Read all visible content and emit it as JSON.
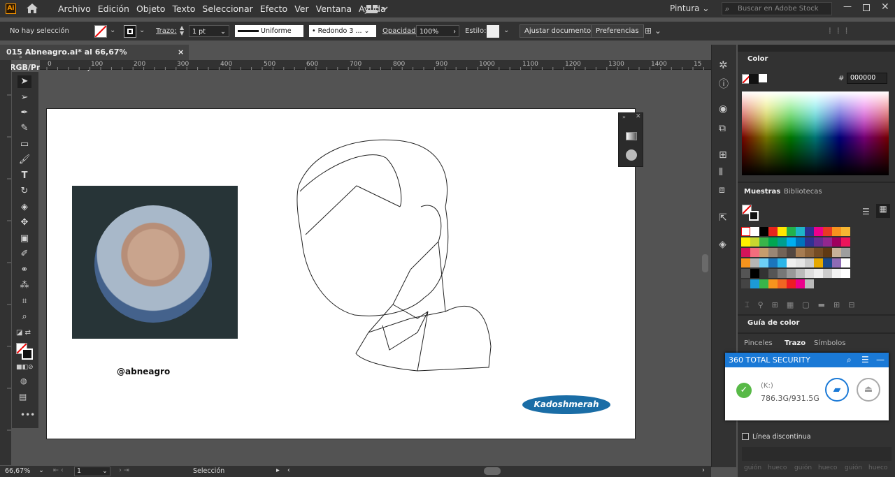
{
  "app": {
    "logo": "Ai",
    "menu": [
      "Archivo",
      "Edición",
      "Objeto",
      "Texto",
      "Seleccionar",
      "Efecto",
      "Ver",
      "Ventana",
      "Ayuda"
    ],
    "workspace": "Pintura",
    "search_placeholder": "Buscar en Adobe Stock"
  },
  "control": {
    "selection": "No hay selección",
    "stroke_label": "Trazo:",
    "stroke_value": "1 pt",
    "stroke_style": "Uniforme",
    "brush": "Redondo 3 ...",
    "opacity_label": "Opacidad:",
    "opacity_value": "100%",
    "style_label": "Estilo:",
    "doc_setup": "Ajustar documento",
    "prefs": "Preferencias"
  },
  "document": {
    "tab_title": "015 Abneagro.ai* al 66,67% (RGB/Previsualizar)",
    "close": "×"
  },
  "ruler": {
    "ticks": [
      "0",
      "100",
      "200",
      "300",
      "400",
      "500",
      "600",
      "700",
      "800",
      "900",
      "1000",
      "1100",
      "1200",
      "1300",
      "1400",
      "15"
    ]
  },
  "artwork": {
    "handle": "@abneagro",
    "badge": "Kadoshmerah"
  },
  "panels": {
    "color_tab": "Color",
    "hex_prefix": "#",
    "hex_value": "000000",
    "swatches_tab": "Muestras",
    "libraries_tab": "Bibliotecas",
    "color_guide_tab": "Guía de color",
    "brushes_tab": "Pinceles",
    "stroke_tab": "Trazo",
    "symbols_tab": "Símbolos",
    "dashed_line": "Línea discontinua",
    "dash_labels": [
      "guión",
      "hueco",
      "guión",
      "hueco",
      "guión",
      "hueco"
    ]
  },
  "security_popup": {
    "title": "360 TOTAL SECURITY",
    "drive": "(K:)",
    "space": "786.3G/931.5G"
  },
  "status": {
    "zoom": "66,67%",
    "artboard": "1",
    "tool": "Selección"
  },
  "colors": {
    "accent_blue": "#1a79d6",
    "badge_blue": "#1a6da6",
    "ui_dark": "#323232",
    "canvas_bg": "#535353"
  }
}
